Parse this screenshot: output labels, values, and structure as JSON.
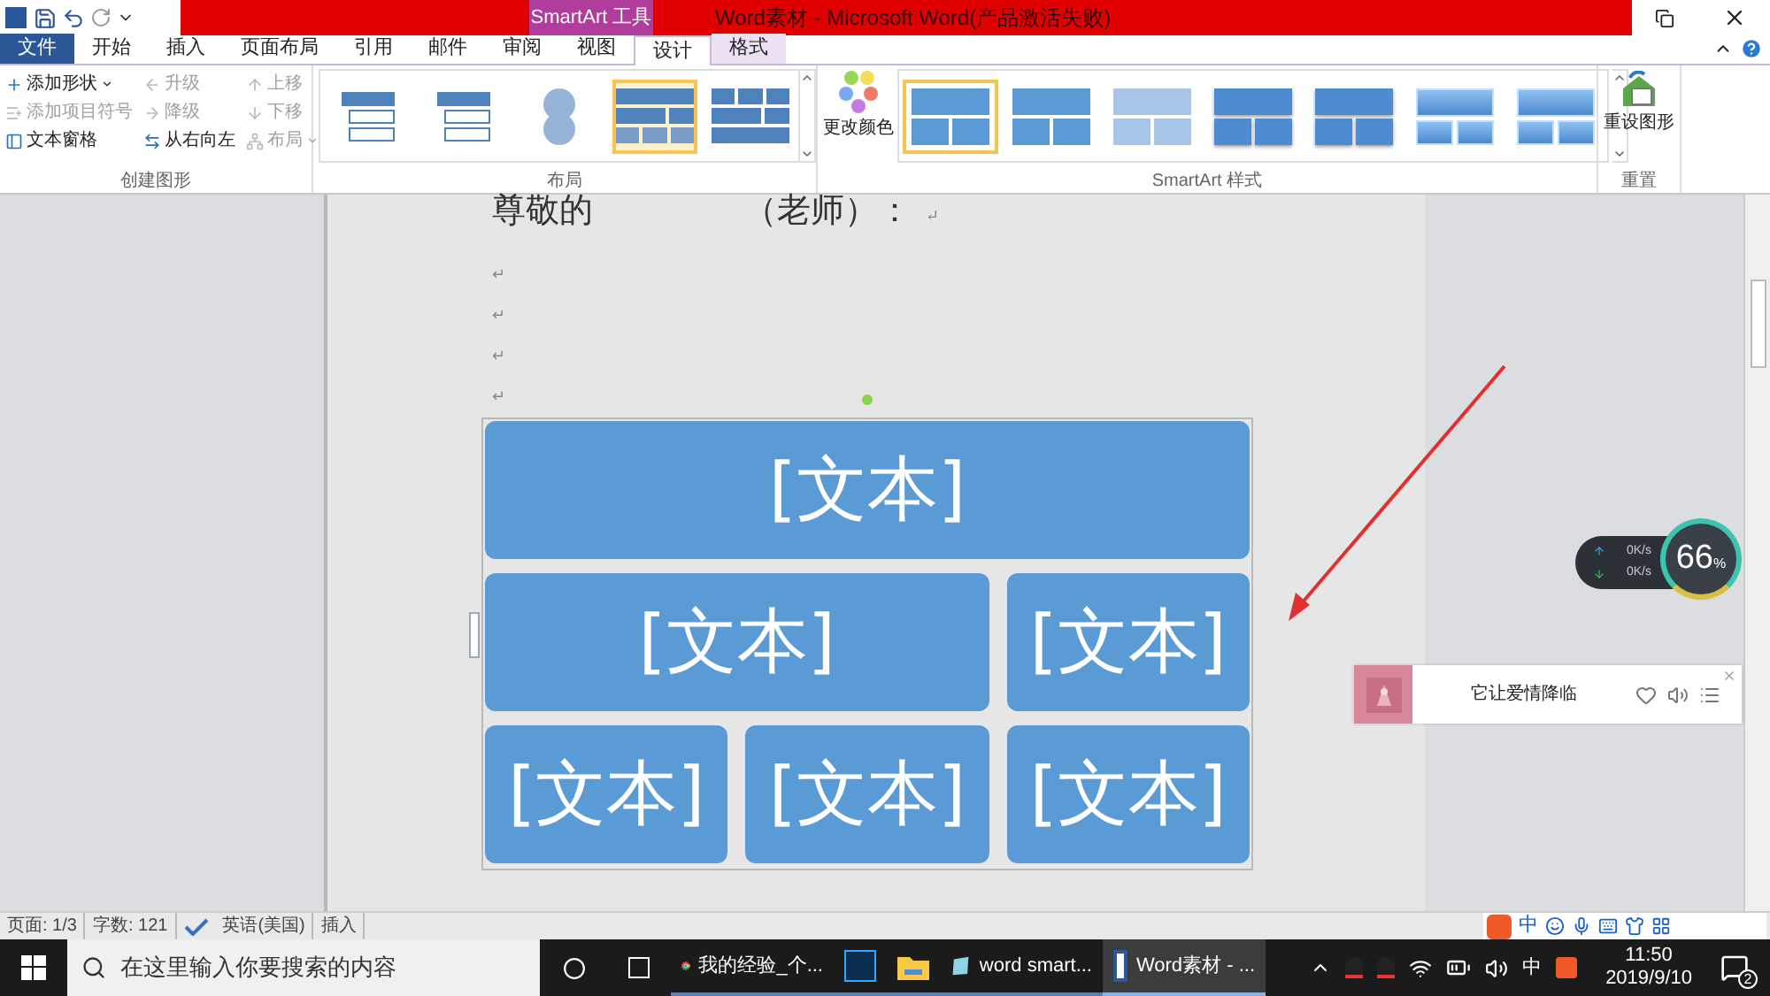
{
  "title_bar": {
    "contextual_tab": "SmartArt 工具",
    "title": "Word素材 - Microsoft Word(产品激活失败)"
  },
  "tabs": [
    {
      "label": "文件",
      "kind": "file",
      "selected": false
    },
    {
      "label": "开始",
      "kind": "normal",
      "selected": false
    },
    {
      "label": "插入",
      "kind": "normal",
      "selected": false
    },
    {
      "label": "页面布局",
      "kind": "normal",
      "selected": false
    },
    {
      "label": "引用",
      "kind": "normal",
      "selected": false
    },
    {
      "label": "邮件",
      "kind": "normal",
      "selected": false
    },
    {
      "label": "审阅",
      "kind": "normal",
      "selected": false
    },
    {
      "label": "视图",
      "kind": "normal",
      "selected": false
    },
    {
      "label": "设计",
      "kind": "contextual",
      "selected": true
    },
    {
      "label": "格式",
      "kind": "contextual",
      "selected": false
    }
  ],
  "create_group": {
    "title": "创建图形",
    "columns": [
      [
        {
          "label": "添加形状",
          "disabled": false,
          "dropdown": true
        },
        {
          "label": "添加项目符号",
          "disabled": true,
          "dropdown": false
        },
        {
          "label": "文本窗格",
          "disabled": false,
          "dropdown": false
        }
      ],
      [
        {
          "label": "升级",
          "disabled": true,
          "dropdown": false
        },
        {
          "label": "降级",
          "disabled": true,
          "dropdown": false
        },
        {
          "label": "从右向左",
          "disabled": false,
          "dropdown": false
        }
      ],
      [
        {
          "label": "上移",
          "disabled": true,
          "dropdown": false
        },
        {
          "label": "下移",
          "disabled": true,
          "dropdown": false
        },
        {
          "label": "布局",
          "disabled": true,
          "dropdown": true
        }
      ]
    ]
  },
  "layout_group": {
    "title": "布局",
    "thumbnails": [
      {
        "kind": "list",
        "selected": false
      },
      {
        "kind": "list",
        "selected": false
      },
      {
        "kind": "circles",
        "selected": false
      },
      {
        "kind": "hierarchy",
        "selected": true
      },
      {
        "kind": "blocks",
        "selected": false
      }
    ]
  },
  "styles_group": {
    "title": "SmartArt 样式",
    "change_colors": "更改颜色",
    "thumbnails": [
      {
        "kind": "flat",
        "selected": true
      },
      {
        "kind": "flat",
        "selected": false
      },
      {
        "kind": "faded",
        "selected": false
      },
      {
        "kind": "shaded",
        "selected": false
      },
      {
        "kind": "shaded",
        "selected": false
      },
      {
        "kind": "glossy",
        "selected": false
      },
      {
        "kind": "glossy",
        "selected": false
      }
    ]
  },
  "reset_group": {
    "title": "重置",
    "button": "重设图形"
  },
  "document": {
    "heading_left": "尊敬的",
    "heading_right": "（老师）：",
    "paragraph_marks": [
      "↵",
      "↵",
      "↵",
      "↵",
      "↵"
    ],
    "smartart_rows": [
      [
        "[文本]"
      ],
      [
        "[文本]",
        "[文本]"
      ],
      [
        "[文本]",
        "[文本]",
        "[文本]"
      ]
    ]
  },
  "speed_widget": {
    "upload": "0K/s",
    "download": "0K/s",
    "value": "66",
    "unit": "%"
  },
  "music_player": {
    "song": "它让爱情降临"
  },
  "ime_toolbar": {
    "mode": "中"
  },
  "status_bar": [
    "页面: 1/3",
    "字数: 121",
    "英语(美国)",
    "插入"
  ],
  "taskbar": {
    "search_placeholder": "在这里输入你要搜索的内容",
    "apps": [
      {
        "kind": "chrome",
        "label": "我的经验_个...",
        "selected": false
      },
      {
        "kind": "ps",
        "selected": false
      },
      {
        "kind": "folder",
        "selected": false
      },
      {
        "kind": "app",
        "label": "word smart...",
        "selected": false
      },
      {
        "kind": "word",
        "label": "Word素材 - ...",
        "selected": true
      }
    ],
    "ime": "中",
    "time": "11:50",
    "date": "2019/9/10",
    "notifications": "2"
  }
}
